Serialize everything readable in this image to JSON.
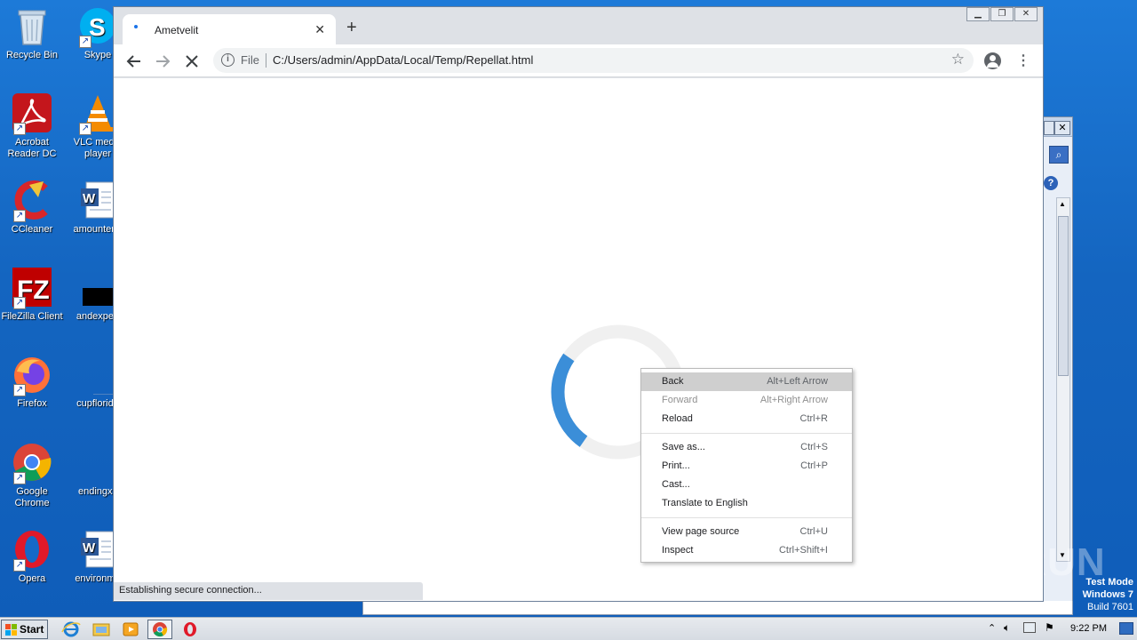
{
  "desktop": {
    "icons": [
      {
        "label": "Recycle Bin"
      },
      {
        "label": "Skype"
      },
      {
        "label": "Acrobat Reader DC"
      },
      {
        "label": "VLC media player"
      },
      {
        "label": "CCleaner"
      },
      {
        "label": "amountene"
      },
      {
        "label": "FileZilla Client"
      },
      {
        "label": "andexperi"
      },
      {
        "label": "Firefox"
      },
      {
        "label": "cupflorida"
      },
      {
        "label": "Google Chrome"
      },
      {
        "label": "endingxx"
      },
      {
        "label": "Opera"
      },
      {
        "label": "environme"
      }
    ]
  },
  "browser": {
    "tab_title": "Ametvelit",
    "new_tab_symbol": "+",
    "tab_close_symbol": "✕",
    "address_scheme": "File",
    "address_url": "C:/Users/admin/AppData/Local/Temp/Repellat.html",
    "status_text": "Establishing secure connection...",
    "spinner_progress": 0.25
  },
  "context_menu": {
    "items": [
      {
        "label": "Back",
        "shortcut": "Alt+Left Arrow",
        "state": "highlighted"
      },
      {
        "label": "Forward",
        "shortcut": "Alt+Right Arrow",
        "state": "disabled"
      },
      {
        "label": "Reload",
        "shortcut": "Ctrl+R",
        "state": "normal"
      },
      {
        "label": "Save as...",
        "shortcut": "Ctrl+S",
        "state": "normal"
      },
      {
        "label": "Print...",
        "shortcut": "Ctrl+P",
        "state": "normal"
      },
      {
        "label": "Cast...",
        "shortcut": "",
        "state": "normal"
      },
      {
        "label": "Translate to English",
        "shortcut": "",
        "state": "normal"
      },
      {
        "label": "View page source",
        "shortcut": "Ctrl+U",
        "state": "normal"
      },
      {
        "label": "Inspect",
        "shortcut": "Ctrl+Shift+I",
        "state": "normal"
      }
    ]
  },
  "watermark": {
    "text": "ANY RUN"
  },
  "os_overlay": {
    "line1": "Test Mode",
    "line2": "Windows 7",
    "line3": "Build 7601"
  },
  "taskbar": {
    "start_label": "Start",
    "clock": "9:22 PM"
  },
  "colors": {
    "desktop_blue": "#1569c7",
    "spinner_blue": "#3b8ed8",
    "spinner_track": "#f0f0f0",
    "menu_highlight": "#cfcfcf"
  }
}
